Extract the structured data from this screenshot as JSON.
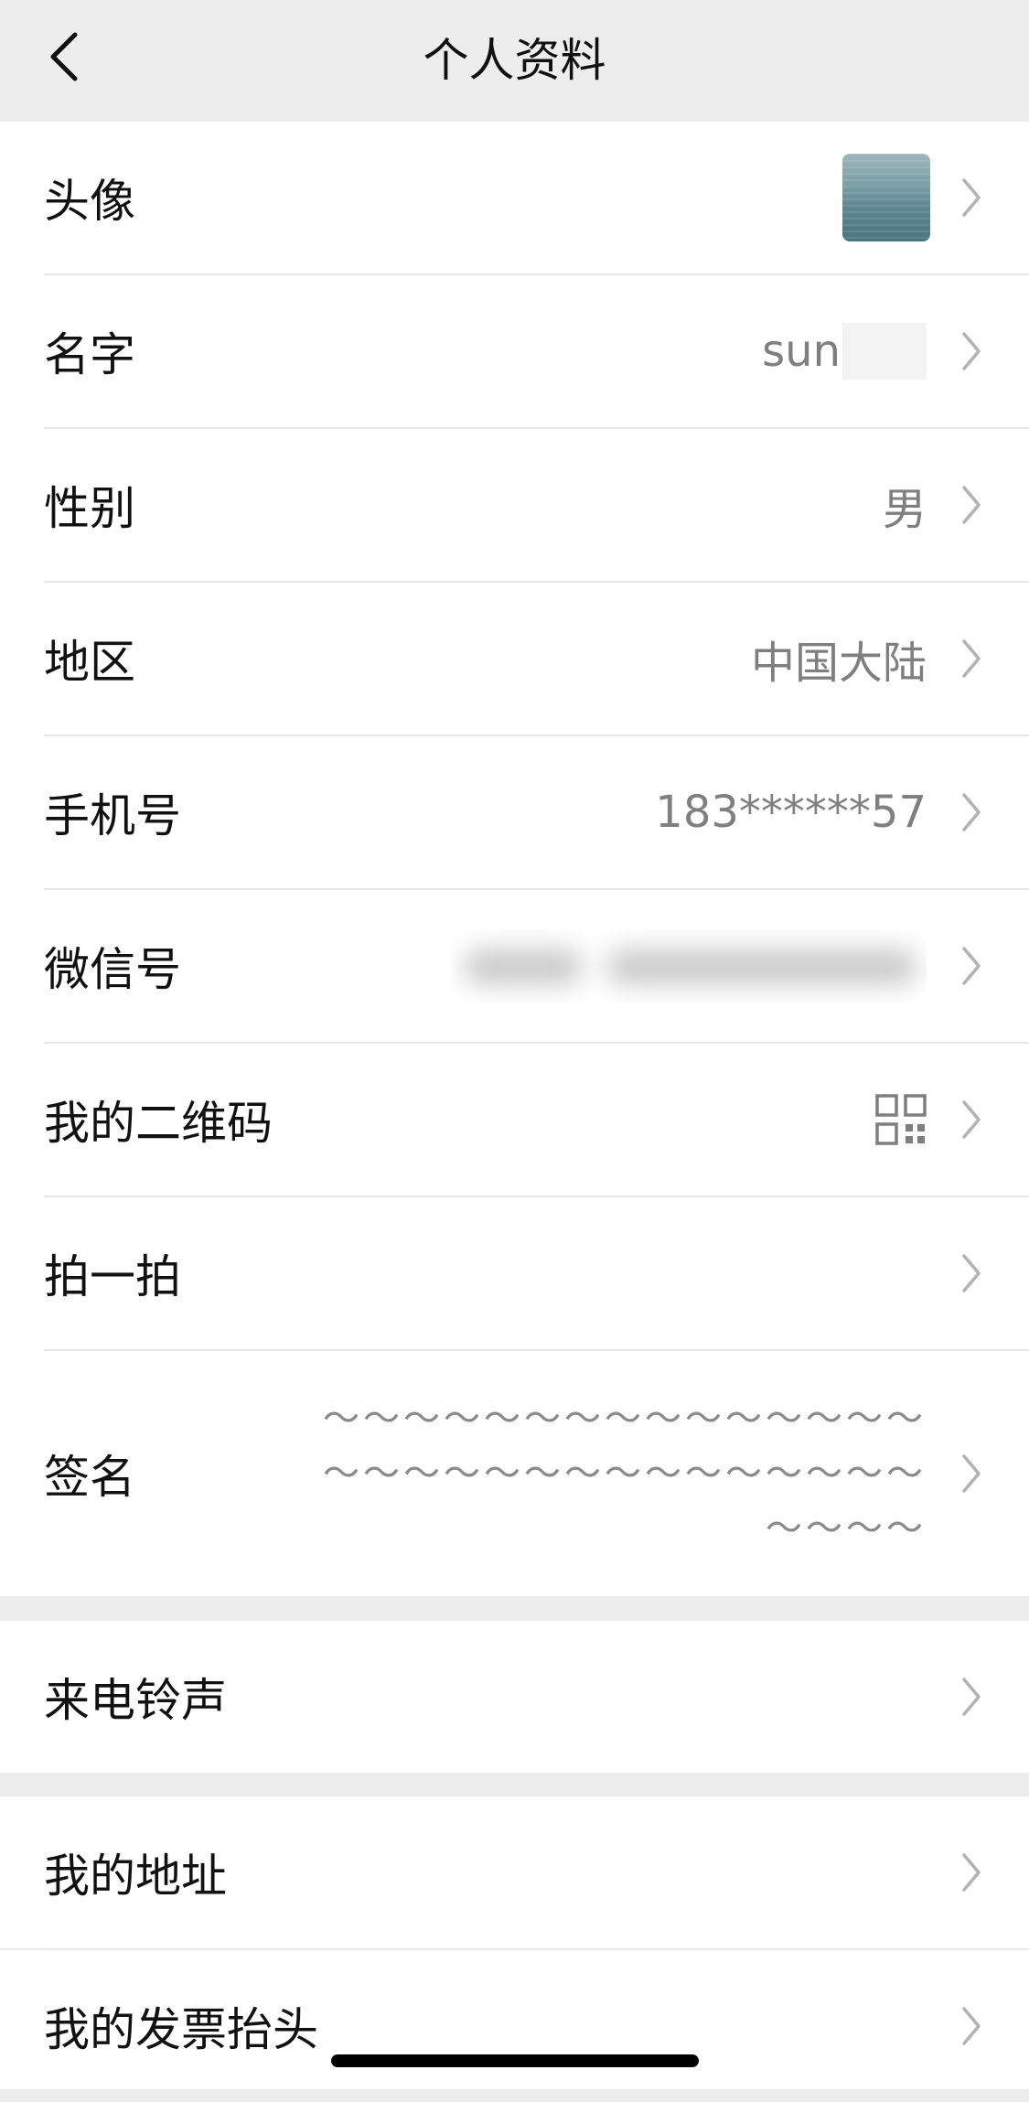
{
  "header": {
    "title": "个人资料",
    "back_icon": "chevron-left-icon"
  },
  "rows": {
    "avatar": {
      "label": "头像"
    },
    "name": {
      "label": "名字",
      "value": "sun"
    },
    "gender": {
      "label": "性别",
      "value": "男"
    },
    "region": {
      "label": "地区",
      "value": "中国大陆"
    },
    "phone": {
      "label": "手机号",
      "value": "183******57"
    },
    "wechat_id": {
      "label": "微信号"
    },
    "qrcode": {
      "label": "我的二维码",
      "icon": "qr-code-icon"
    },
    "pat": {
      "label": "拍一拍"
    },
    "signature": {
      "label": "签名",
      "value": "～～～～～～～～～～～～～～～～～～～～～～～～～～～～～～～～～～"
    },
    "ringtone": {
      "label": "来电铃声"
    },
    "address": {
      "label": "我的地址"
    },
    "invoice": {
      "label": "我的发票抬头"
    }
  },
  "icons": {
    "row_chevron": "chevron-right-icon"
  },
  "colors": {
    "background": "#ededed",
    "row_background": "#ffffff",
    "primary_text": "#111111",
    "secondary_text": "#7f7f7f",
    "chevron": "#b2b2b2"
  }
}
